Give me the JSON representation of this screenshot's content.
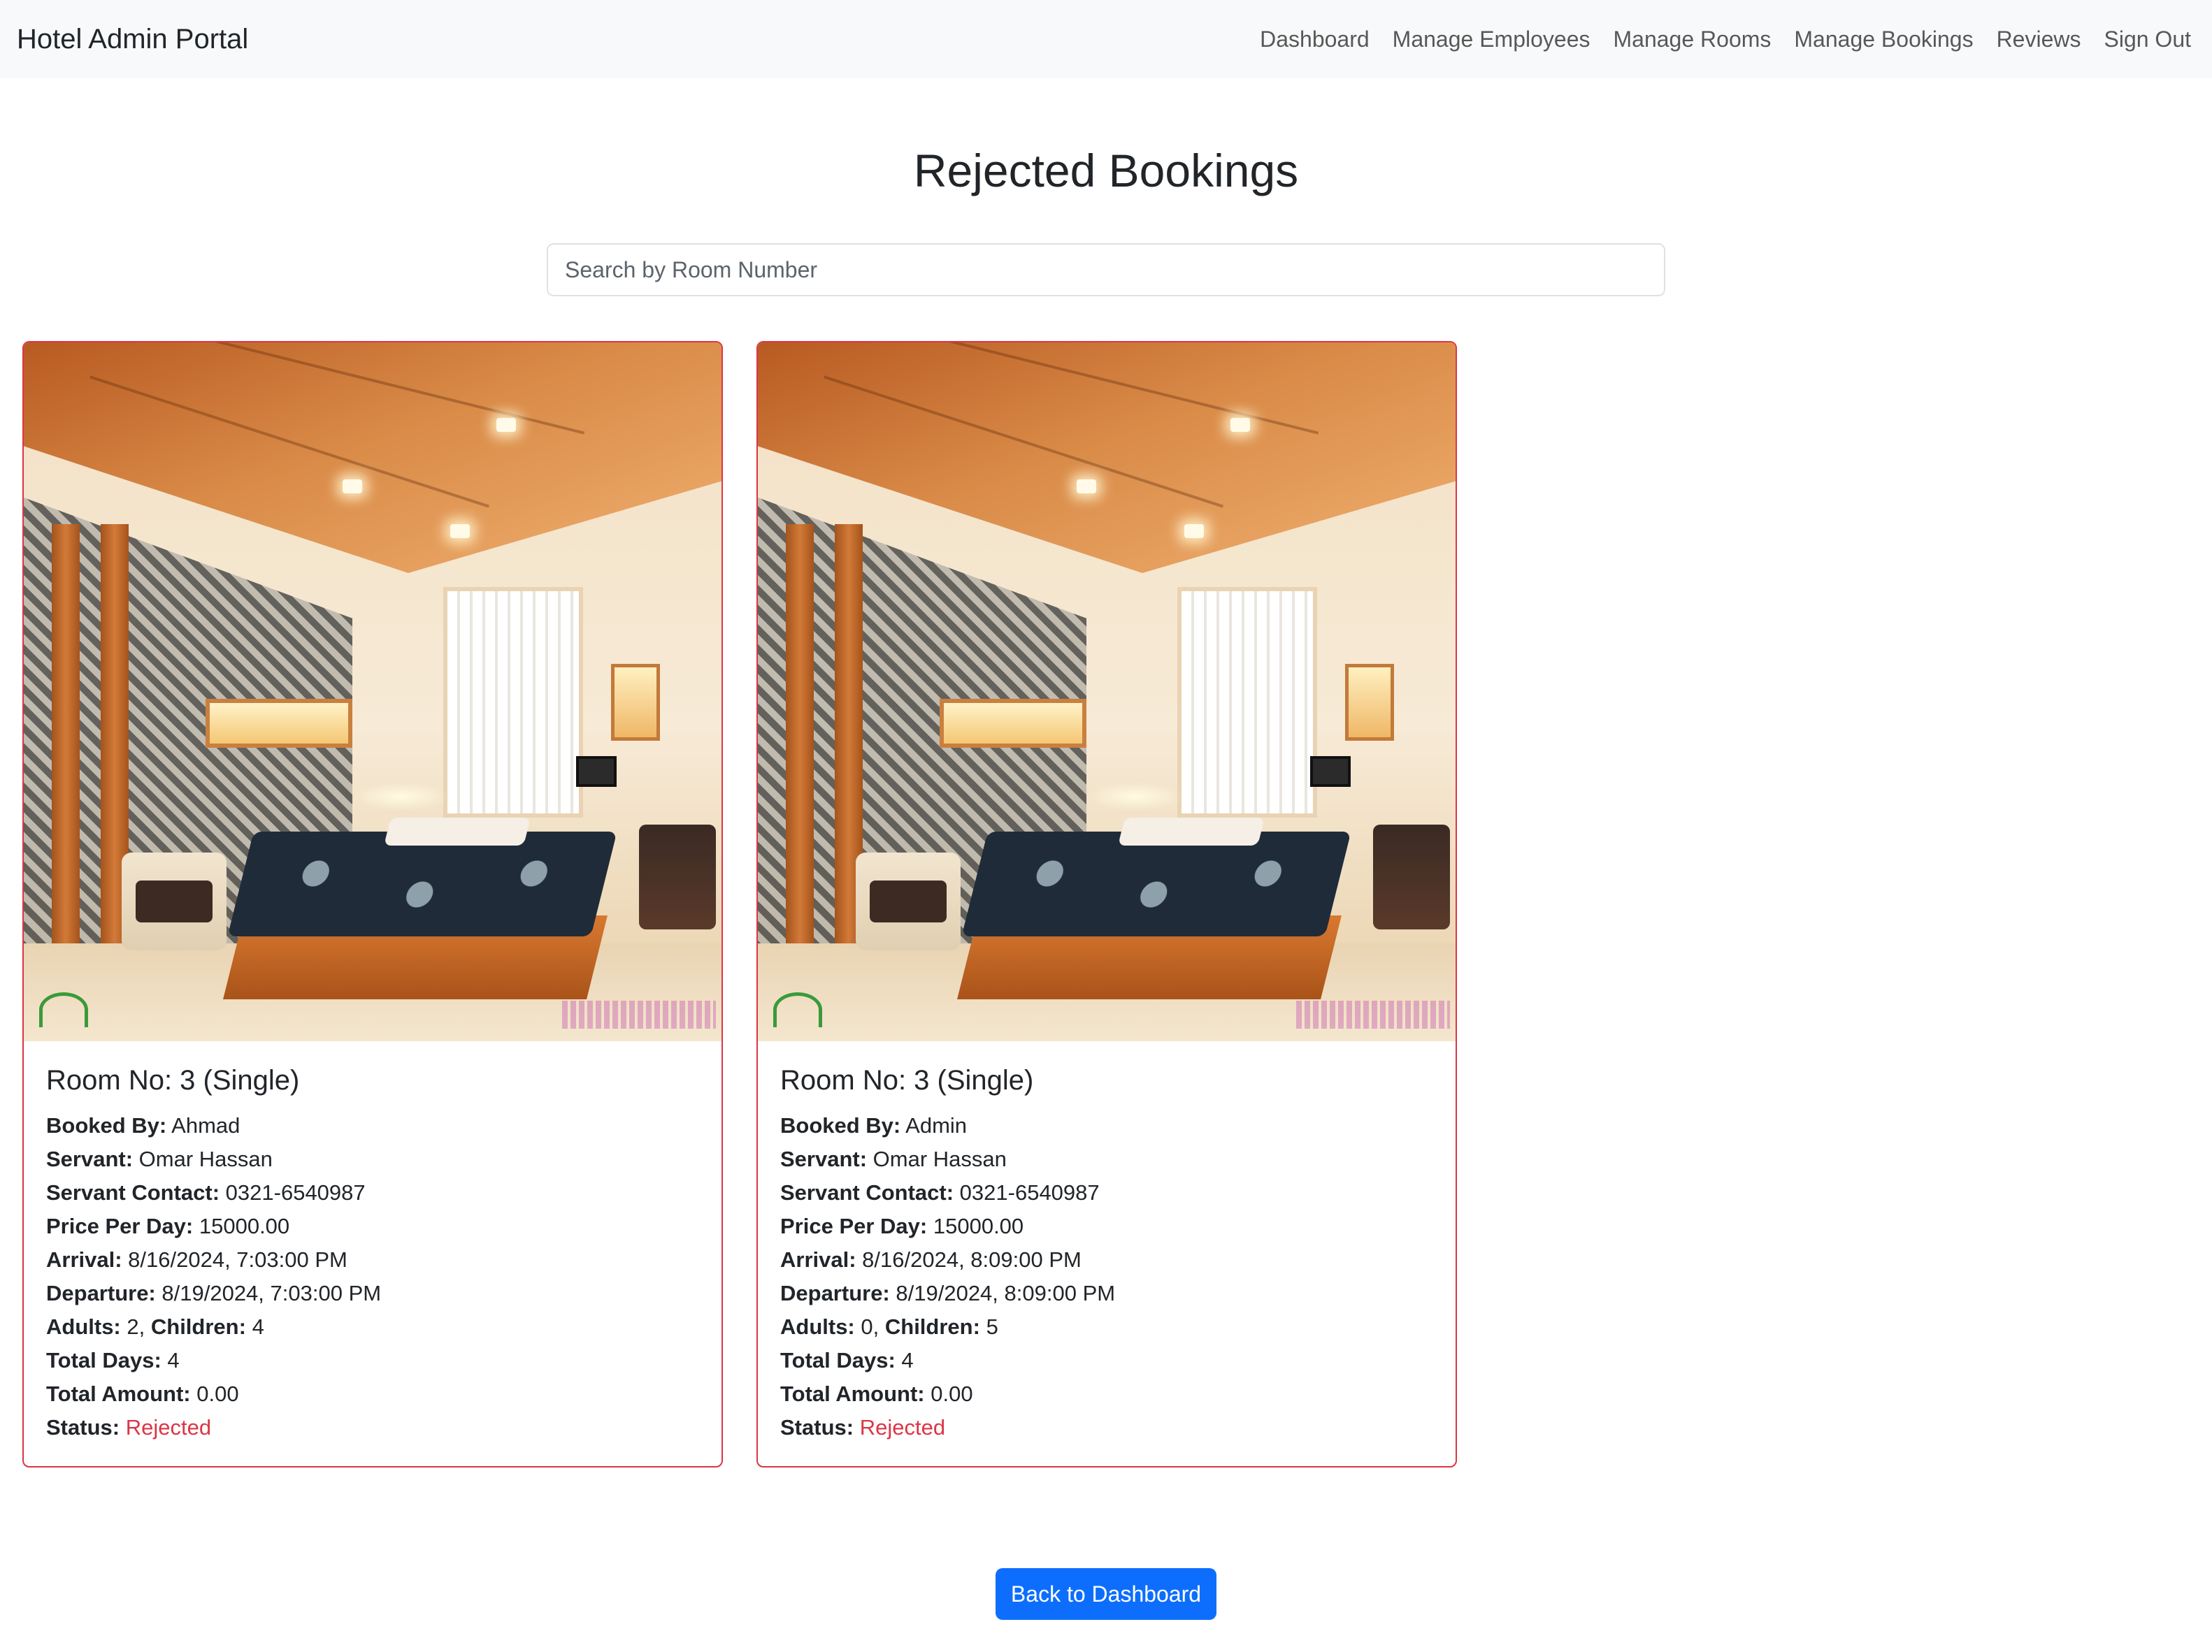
{
  "navbar": {
    "brand": "Hotel Admin Portal",
    "links": [
      {
        "label": "Dashboard"
      },
      {
        "label": "Manage Employees"
      },
      {
        "label": "Manage Rooms"
      },
      {
        "label": "Manage Bookings"
      },
      {
        "label": "Reviews"
      },
      {
        "label": "Sign Out"
      }
    ]
  },
  "page": {
    "title": "Rejected Bookings",
    "search_placeholder": "Search by Room Number",
    "search_value": ""
  },
  "labels": {
    "booked_by": "Booked By:",
    "servant": "Servant:",
    "servant_contact": "Servant Contact:",
    "price_per_day": "Price Per Day:",
    "arrival": "Arrival:",
    "departure": "Departure:",
    "adults": "Adults:",
    "children": "Children:",
    "total_days": "Total Days:",
    "total_amount": "Total Amount:",
    "status": "Status:"
  },
  "bookings": [
    {
      "title": "Room No: 3 (Single)",
      "booked_by": "Ahmad",
      "servant": "Omar Hassan",
      "servant_contact": "0321-6540987",
      "price_per_day": "15000.00",
      "arrival": "8/16/2024, 7:03:00 PM",
      "departure": "8/19/2024, 7:03:00 PM",
      "adults": "2",
      "children": "4",
      "total_days": "4",
      "total_amount": "0.00",
      "status": "Rejected"
    },
    {
      "title": "Room No: 3 (Single)",
      "booked_by": "Admin",
      "servant": "Omar Hassan",
      "servant_contact": "0321-6540987",
      "price_per_day": "15000.00",
      "arrival": "8/16/2024, 8:09:00 PM",
      "departure": "8/19/2024, 8:09:00 PM",
      "adults": "0",
      "children": "5",
      "total_days": "4",
      "total_amount": "0.00",
      "status": "Rejected"
    }
  ],
  "footer": {
    "back_button": "Back to Dashboard"
  },
  "colors": {
    "navbar_bg": "#f8f9fa",
    "card_border": "#dc3545",
    "status_rejected": "#dc3545",
    "primary_button": "#0d6efd"
  }
}
